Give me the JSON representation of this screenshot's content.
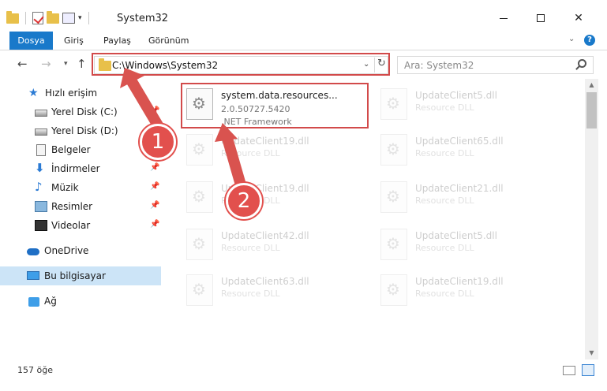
{
  "window": {
    "title": "System32",
    "controls": {
      "minimize": "—",
      "maximize": "□",
      "close": "✕"
    }
  },
  "ribbon": {
    "tabs": [
      {
        "label": "Dosya",
        "active": true
      },
      {
        "label": "Giriş"
      },
      {
        "label": "Paylaş"
      },
      {
        "label": "Görünüm"
      }
    ],
    "collapse_glyph": "⌄",
    "help_glyph": "?"
  },
  "navigation": {
    "back_glyph": "←",
    "forward_glyph": "→",
    "recent_glyph": "▾",
    "up_glyph": "↑",
    "address": "C:\\Windows\\System32",
    "address_drop_glyph": "⌄",
    "refresh_glyph": "↻",
    "search_placeholder": "Ara: System32"
  },
  "sidebar": {
    "items": [
      {
        "label": "Hızlı erişim",
        "icon": "star-icon"
      },
      {
        "label": "Yerel Disk (C:)",
        "icon": "drive-icon",
        "pinned": true
      },
      {
        "label": "Yerel Disk (D:)",
        "icon": "drive-icon"
      },
      {
        "label": "Belgeler",
        "icon": "documents-icon"
      },
      {
        "label": "İndirmeler",
        "icon": "downloads-icon",
        "pinned": true
      },
      {
        "label": "Müzik",
        "icon": "music-icon",
        "pinned": true
      },
      {
        "label": "Resimler",
        "icon": "pictures-icon",
        "pinned": true
      },
      {
        "label": "Videolar",
        "icon": "videos-icon",
        "pinned": true
      },
      {
        "label": "OneDrive",
        "icon": "onedrive-icon"
      },
      {
        "label": "Bu bilgisayar",
        "icon": "this-pc-icon",
        "selected": true
      },
      {
        "label": "Ağ",
        "icon": "network-icon"
      }
    ],
    "pin_glyph": "📌"
  },
  "files": [
    {
      "name": "system.data.resources...",
      "version": "2.0.50727.5420",
      "type": ".NET Framework",
      "highlighted": true
    },
    {
      "name": "UpdateClient5.dll",
      "type": "Resource DLL"
    },
    {
      "name": "UpdateClient19.dll",
      "type": "Resource DLL"
    },
    {
      "name": "UpdateClient65.dll",
      "type": "Resource DLL"
    },
    {
      "name": "UpdateClient19.dll",
      "type": "Resource DLL"
    },
    {
      "name": "UpdateClient21.dll",
      "type": "Resource DLL"
    },
    {
      "name": "UpdateClient42.dll",
      "type": "Resource DLL"
    },
    {
      "name": "UpdateClient5.dll",
      "type": "Resource DLL"
    },
    {
      "name": "UpdateClient63.dll",
      "type": "Resource DLL"
    },
    {
      "name": "UpdateClient19.dll",
      "type": "Resource DLL"
    }
  ],
  "scrollbar": {
    "up_glyph": "▲",
    "down_glyph": "▼"
  },
  "status": {
    "item_count": "157 öğe"
  },
  "annotations": {
    "step1": "1",
    "step2": "2",
    "color": "#d9534f"
  }
}
